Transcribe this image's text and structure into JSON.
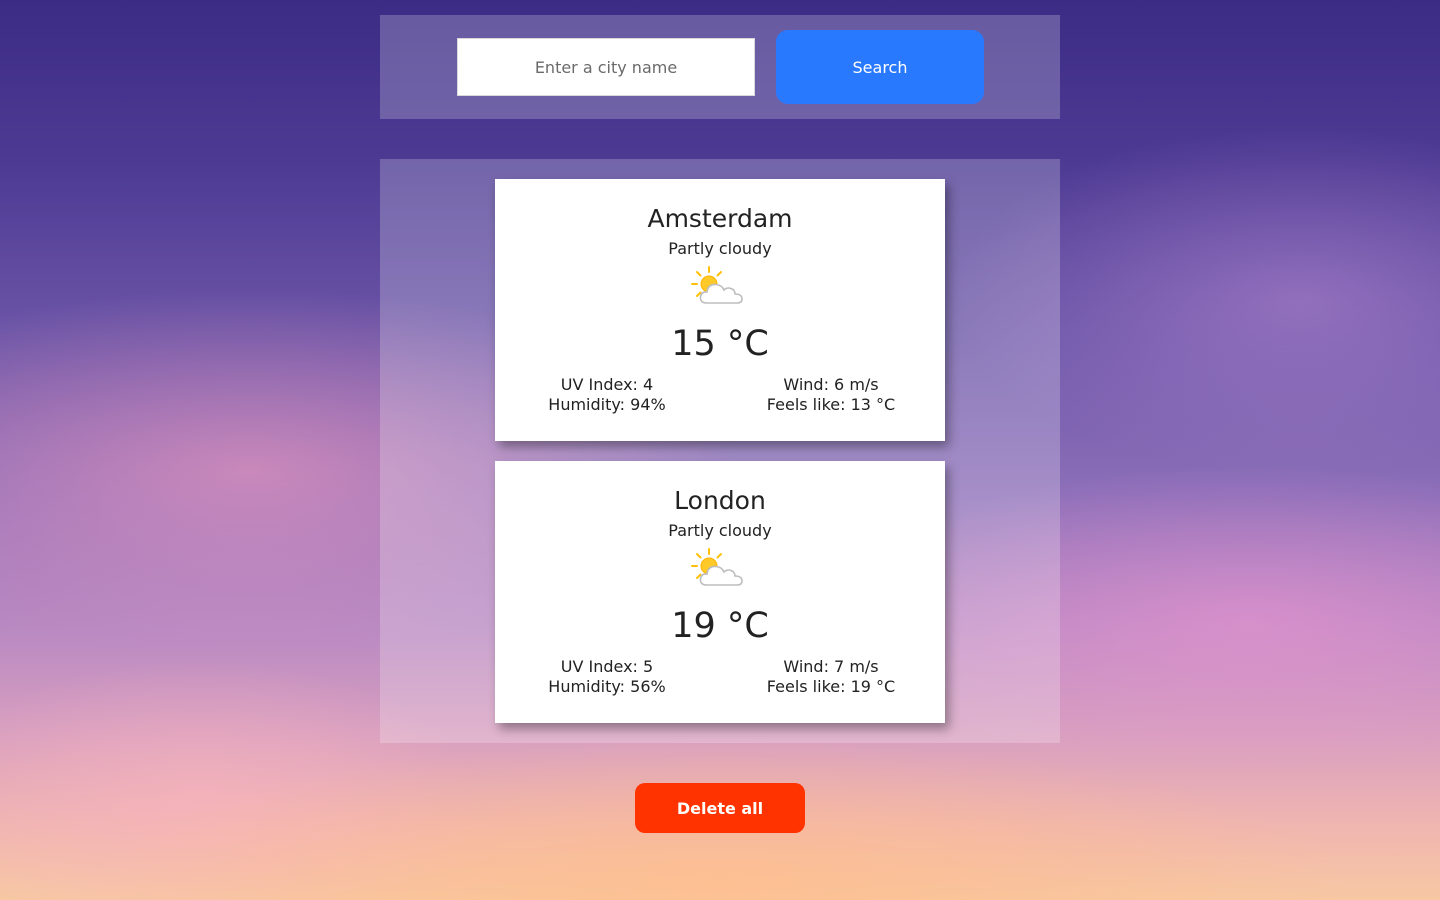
{
  "search": {
    "placeholder": "Enter a city name",
    "value": "",
    "button_label": "Search"
  },
  "cards": [
    {
      "city": "Amsterdam",
      "condition": "Partly cloudy",
      "icon": "partly-cloudy-icon",
      "temperature": "15 °C",
      "uv": "UV Index: 4",
      "humidity": "Humidity: 94%",
      "wind": "Wind: 6 m/s",
      "feels_like": "Feels like: 13 °C"
    },
    {
      "city": "London",
      "condition": "Partly cloudy",
      "icon": "partly-cloudy-icon",
      "temperature": "19 °C",
      "uv": "UV Index: 5",
      "humidity": "Humidity: 56%",
      "wind": "Wind: 7 m/s",
      "feels_like": "Feels like: 19 °C"
    }
  ],
  "actions": {
    "delete_all_label": "Delete all"
  },
  "colors": {
    "search_button": "#2979ff",
    "delete_button": "#ff3300",
    "sun": "#ffc107",
    "cloud_outline": "#bdbdbd"
  }
}
